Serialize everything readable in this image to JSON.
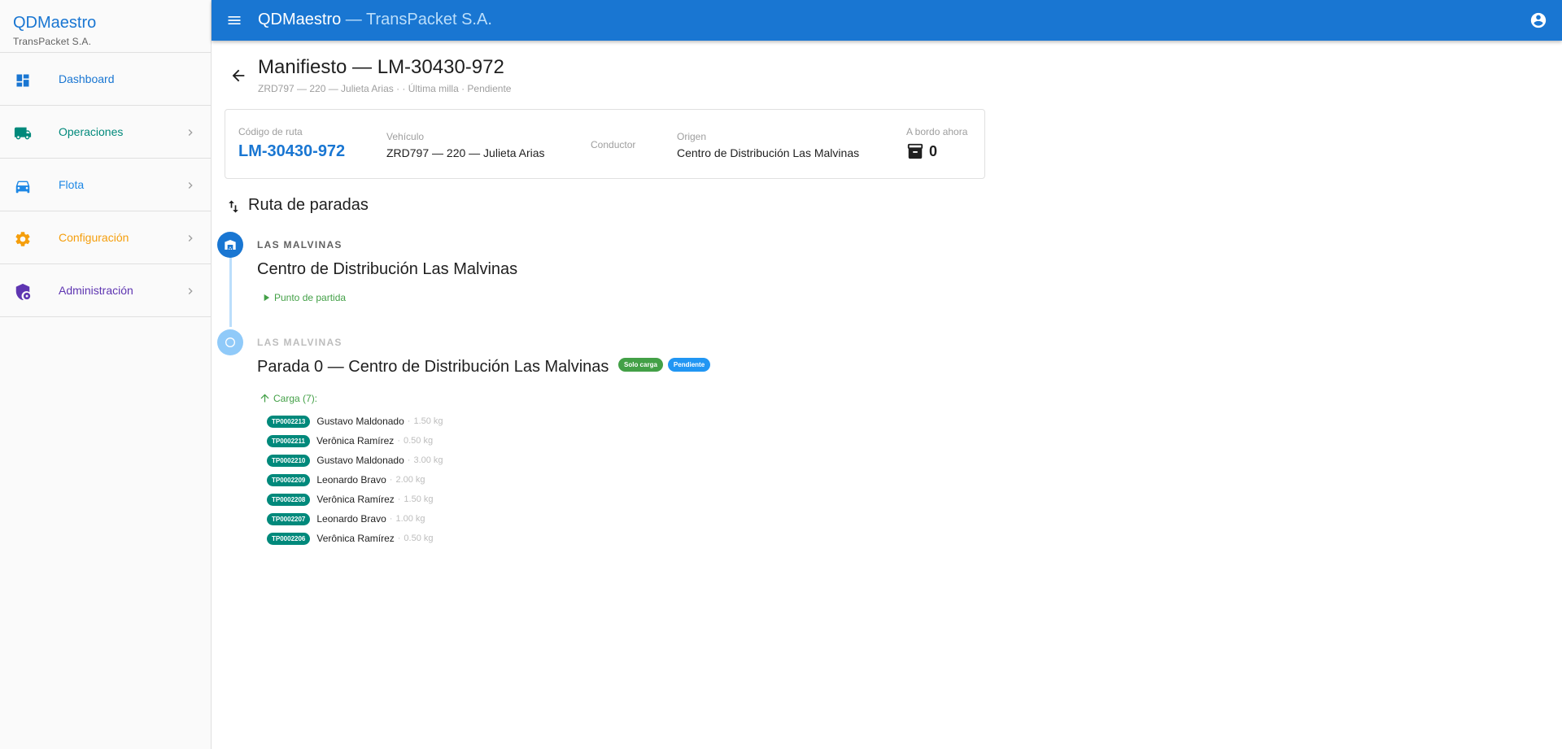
{
  "brand": {
    "title": "QDMaestro",
    "subtitle": "TransPacket S.A."
  },
  "sidebar": {
    "items": [
      {
        "label": "Dashboard",
        "icon": "dashboard-icon",
        "color": "#1976d2",
        "chevron": false
      },
      {
        "label": "Operaciones",
        "icon": "truck-icon",
        "color": "#00897b",
        "chevron": true
      },
      {
        "label": "Flota",
        "icon": "car-icon",
        "color": "#1e88e5",
        "chevron": true
      },
      {
        "label": "Configuración",
        "icon": "gear-icon",
        "color": "#f59e0b",
        "chevron": true
      },
      {
        "label": "Administración",
        "icon": "admin-shield-icon",
        "color": "#5e35b1",
        "chevron": true
      }
    ]
  },
  "topbar": {
    "app": "QDMaestro",
    "separator": " — ",
    "company": "TransPacket S.A."
  },
  "header": {
    "title": "Manifiesto — LM-30430-972",
    "subtitle": "ZRD797 — 220 — Julieta Arias ·  · Última milla · Pendiente"
  },
  "summary": {
    "route_code_label": "Código de ruta",
    "route_code": "LM-30430-972",
    "vehicle_label": "Vehículo",
    "vehicle": "ZRD797 — 220 — Julieta Arias",
    "driver_label": "Conductor",
    "origin_label": "Origen",
    "origin": "Centro de Distribución Las Malvinas",
    "onboard_label": "A bordo ahora",
    "onboard_count": "0"
  },
  "route": {
    "title": "Ruta de paradas",
    "stops": [
      {
        "region": "LAS MALVINAS",
        "name": "Centro de Distribución Las Malvinas",
        "note": "Punto de partida"
      },
      {
        "region": "LAS MALVINAS",
        "name": "Parada 0 — Centro de Distribución Las Malvinas",
        "badges": [
          "Solo carga",
          "Pendiente"
        ],
        "carga_label": "Carga (7):",
        "packages": [
          {
            "id": "TP0002213",
            "name": "Gustavo Maldonado",
            "weight": "1.50 kg"
          },
          {
            "id": "TP0002211",
            "name": "Verônica Ramírez",
            "weight": "0.50 kg"
          },
          {
            "id": "TP0002210",
            "name": "Gustavo Maldonado",
            "weight": "3.00 kg"
          },
          {
            "id": "TP0002209",
            "name": "Leonardo Bravo",
            "weight": "2.00 kg"
          },
          {
            "id": "TP0002208",
            "name": "Verônica Ramírez",
            "weight": "1.50 kg"
          },
          {
            "id": "TP0002207",
            "name": "Leonardo Bravo",
            "weight": "1.00 kg"
          },
          {
            "id": "TP0002206",
            "name": "Verônica Ramírez",
            "weight": "0.50 kg"
          }
        ]
      }
    ]
  },
  "colors": {
    "primary": "#1976d2",
    "success": "#43a047",
    "teal": "#00897b",
    "badge_info": "#2196f3"
  }
}
